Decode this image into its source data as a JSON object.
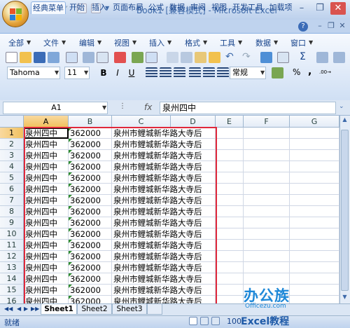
{
  "window": {
    "title": "Book1  [兼容模式] - Microsoft Excel",
    "minimize": "–",
    "restore": "❐",
    "close": "✕"
  },
  "ribbon": {
    "tabs": [
      "经典菜单",
      "开始",
      "插入",
      "页面布局",
      "公式",
      "数据",
      "审阅",
      "视图",
      "开发工具",
      "加载项"
    ],
    "help_icon": "?",
    "menus": [
      "全部",
      "文件",
      "编辑",
      "视图",
      "插入",
      "格式",
      "工具",
      "数据",
      "窗口"
    ],
    "font": "Tahoma",
    "font_size": "11",
    "bold": "B",
    "italic": "I",
    "underline": "U",
    "number_format": "常规",
    "percent": "%",
    "comma": ",",
    "sigma": "Σ"
  },
  "formula_bar": {
    "name_box": "A1",
    "fx": "fx",
    "value": "泉州四中"
  },
  "sheet": {
    "columns": [
      "A",
      "B",
      "C",
      "D",
      "E",
      "F",
      "G"
    ],
    "rows": [
      {
        "n": "1",
        "a": "泉州四中",
        "b": "362000",
        "c": "泉州市鲤城新华路大寺后"
      },
      {
        "n": "2",
        "a": "泉州四中",
        "b": "362000",
        "c": "泉州市鲤城新华路大寺后"
      },
      {
        "n": "3",
        "a": "泉州四中",
        "b": "362000",
        "c": "泉州市鲤城新华路大寺后"
      },
      {
        "n": "4",
        "a": "泉州四中",
        "b": "362000",
        "c": "泉州市鲤城新华路大寺后"
      },
      {
        "n": "5",
        "a": "泉州四中",
        "b": "362000",
        "c": "泉州市鲤城新华路大寺后"
      },
      {
        "n": "6",
        "a": "泉州四中",
        "b": "362000",
        "c": "泉州市鲤城新华路大寺后"
      },
      {
        "n": "7",
        "a": "泉州四中",
        "b": "362000",
        "c": "泉州市鲤城新华路大寺后"
      },
      {
        "n": "8",
        "a": "泉州四中",
        "b": "362000",
        "c": "泉州市鲤城新华路大寺后"
      },
      {
        "n": "9",
        "a": "泉州四中",
        "b": "362000",
        "c": "泉州市鲤城新华路大寺后"
      },
      {
        "n": "10",
        "a": "泉州四中",
        "b": "362000",
        "c": "泉州市鲤城新华路大寺后"
      },
      {
        "n": "11",
        "a": "泉州四中",
        "b": "362000",
        "c": "泉州市鲤城新华路大寺后"
      },
      {
        "n": "12",
        "a": "泉州四中",
        "b": "362000",
        "c": "泉州市鲤城新华路大寺后"
      },
      {
        "n": "13",
        "a": "泉州四中",
        "b": "362000",
        "c": "泉州市鲤城新华路大寺后"
      },
      {
        "n": "14",
        "a": "泉州四中",
        "b": "362000",
        "c": "泉州市鲤城新华路大寺后"
      },
      {
        "n": "15",
        "a": "泉州四中",
        "b": "362000",
        "c": "泉州市鲤城新华路大寺后"
      },
      {
        "n": "16",
        "a": "泉州四中",
        "b": "362000",
        "c": "泉州市鲤城新华路大寺后"
      }
    ],
    "tabs": [
      "Sheet1",
      "Sheet2",
      "Sheet3"
    ]
  },
  "status": {
    "ready": "就绪",
    "zoom": "100"
  },
  "watermark": {
    "brand": "办公族",
    "url": "Officezu.com",
    "caption": "Excel教程"
  },
  "colors": {
    "selection_border": "#e0283a",
    "accent": "#15428b"
  }
}
